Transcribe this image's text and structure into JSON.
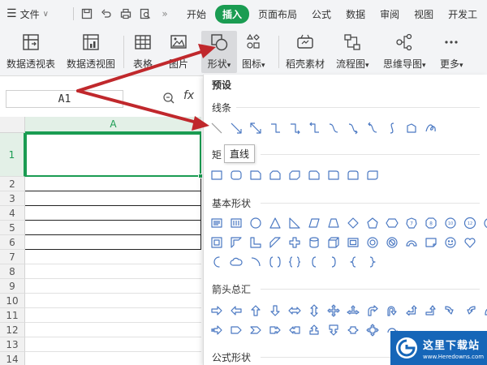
{
  "menubar": {
    "menu_icon": "hamburger-icon",
    "file_label": "文件",
    "file_caret": "∨",
    "quick_icons": [
      "save-icon",
      "undo-icon",
      "print-icon",
      "preview-icon"
    ],
    "more": "»",
    "tabs": [
      {
        "label": "开始",
        "active": false
      },
      {
        "label": "插入",
        "active": true
      },
      {
        "label": "页面布局",
        "active": false
      },
      {
        "label": "公式",
        "active": false
      },
      {
        "label": "数据",
        "active": false
      },
      {
        "label": "审阅",
        "active": false
      },
      {
        "label": "视图",
        "active": false
      },
      {
        "label": "开发工",
        "active": false
      }
    ],
    "accent": "#1a9c52"
  },
  "ribbon": {
    "items": [
      {
        "label": "数据透视表",
        "icon": "pivot-table-icon"
      },
      {
        "label": "数据透视图",
        "icon": "pivot-chart-icon"
      },
      {
        "label": "表格",
        "icon": "table-icon"
      },
      {
        "label": "图片",
        "icon": "picture-icon"
      },
      {
        "label": "形状",
        "icon": "shapes-icon",
        "caret": "▾"
      },
      {
        "label": "图标",
        "icon": "icons-icon",
        "caret": "▾"
      },
      {
        "label": "稻壳素材",
        "icon": "docer-material-icon"
      },
      {
        "label": "流程图",
        "icon": "flowchart-icon",
        "caret": "▾"
      },
      {
        "label": "思维导图",
        "icon": "mindmap-icon",
        "caret": "▾"
      },
      {
        "label": "更多",
        "icon": "more-dots-icon",
        "caret": "▾"
      }
    ]
  },
  "formula": {
    "cell_ref": "A1",
    "fx": "fx",
    "zoom_icon": "zoom-icon"
  },
  "grid": {
    "column_header": "A",
    "row_numbers": [
      "1",
      "2",
      "3",
      "4",
      "5",
      "6",
      "7",
      "8",
      "9",
      "10",
      "11",
      "12",
      "13",
      "14"
    ]
  },
  "panel": {
    "title": "预设",
    "sections": {
      "lines": "线条",
      "rect": "矩",
      "basic": "基本形状",
      "arrows": "箭头总汇",
      "formula": "公式形状"
    },
    "tooltip": "直线",
    "shape_color": "#4a78c2"
  },
  "watermark": {
    "title": "这里下载站",
    "url": "www.Heredowns.com"
  },
  "annotation_color": "#c0282c"
}
